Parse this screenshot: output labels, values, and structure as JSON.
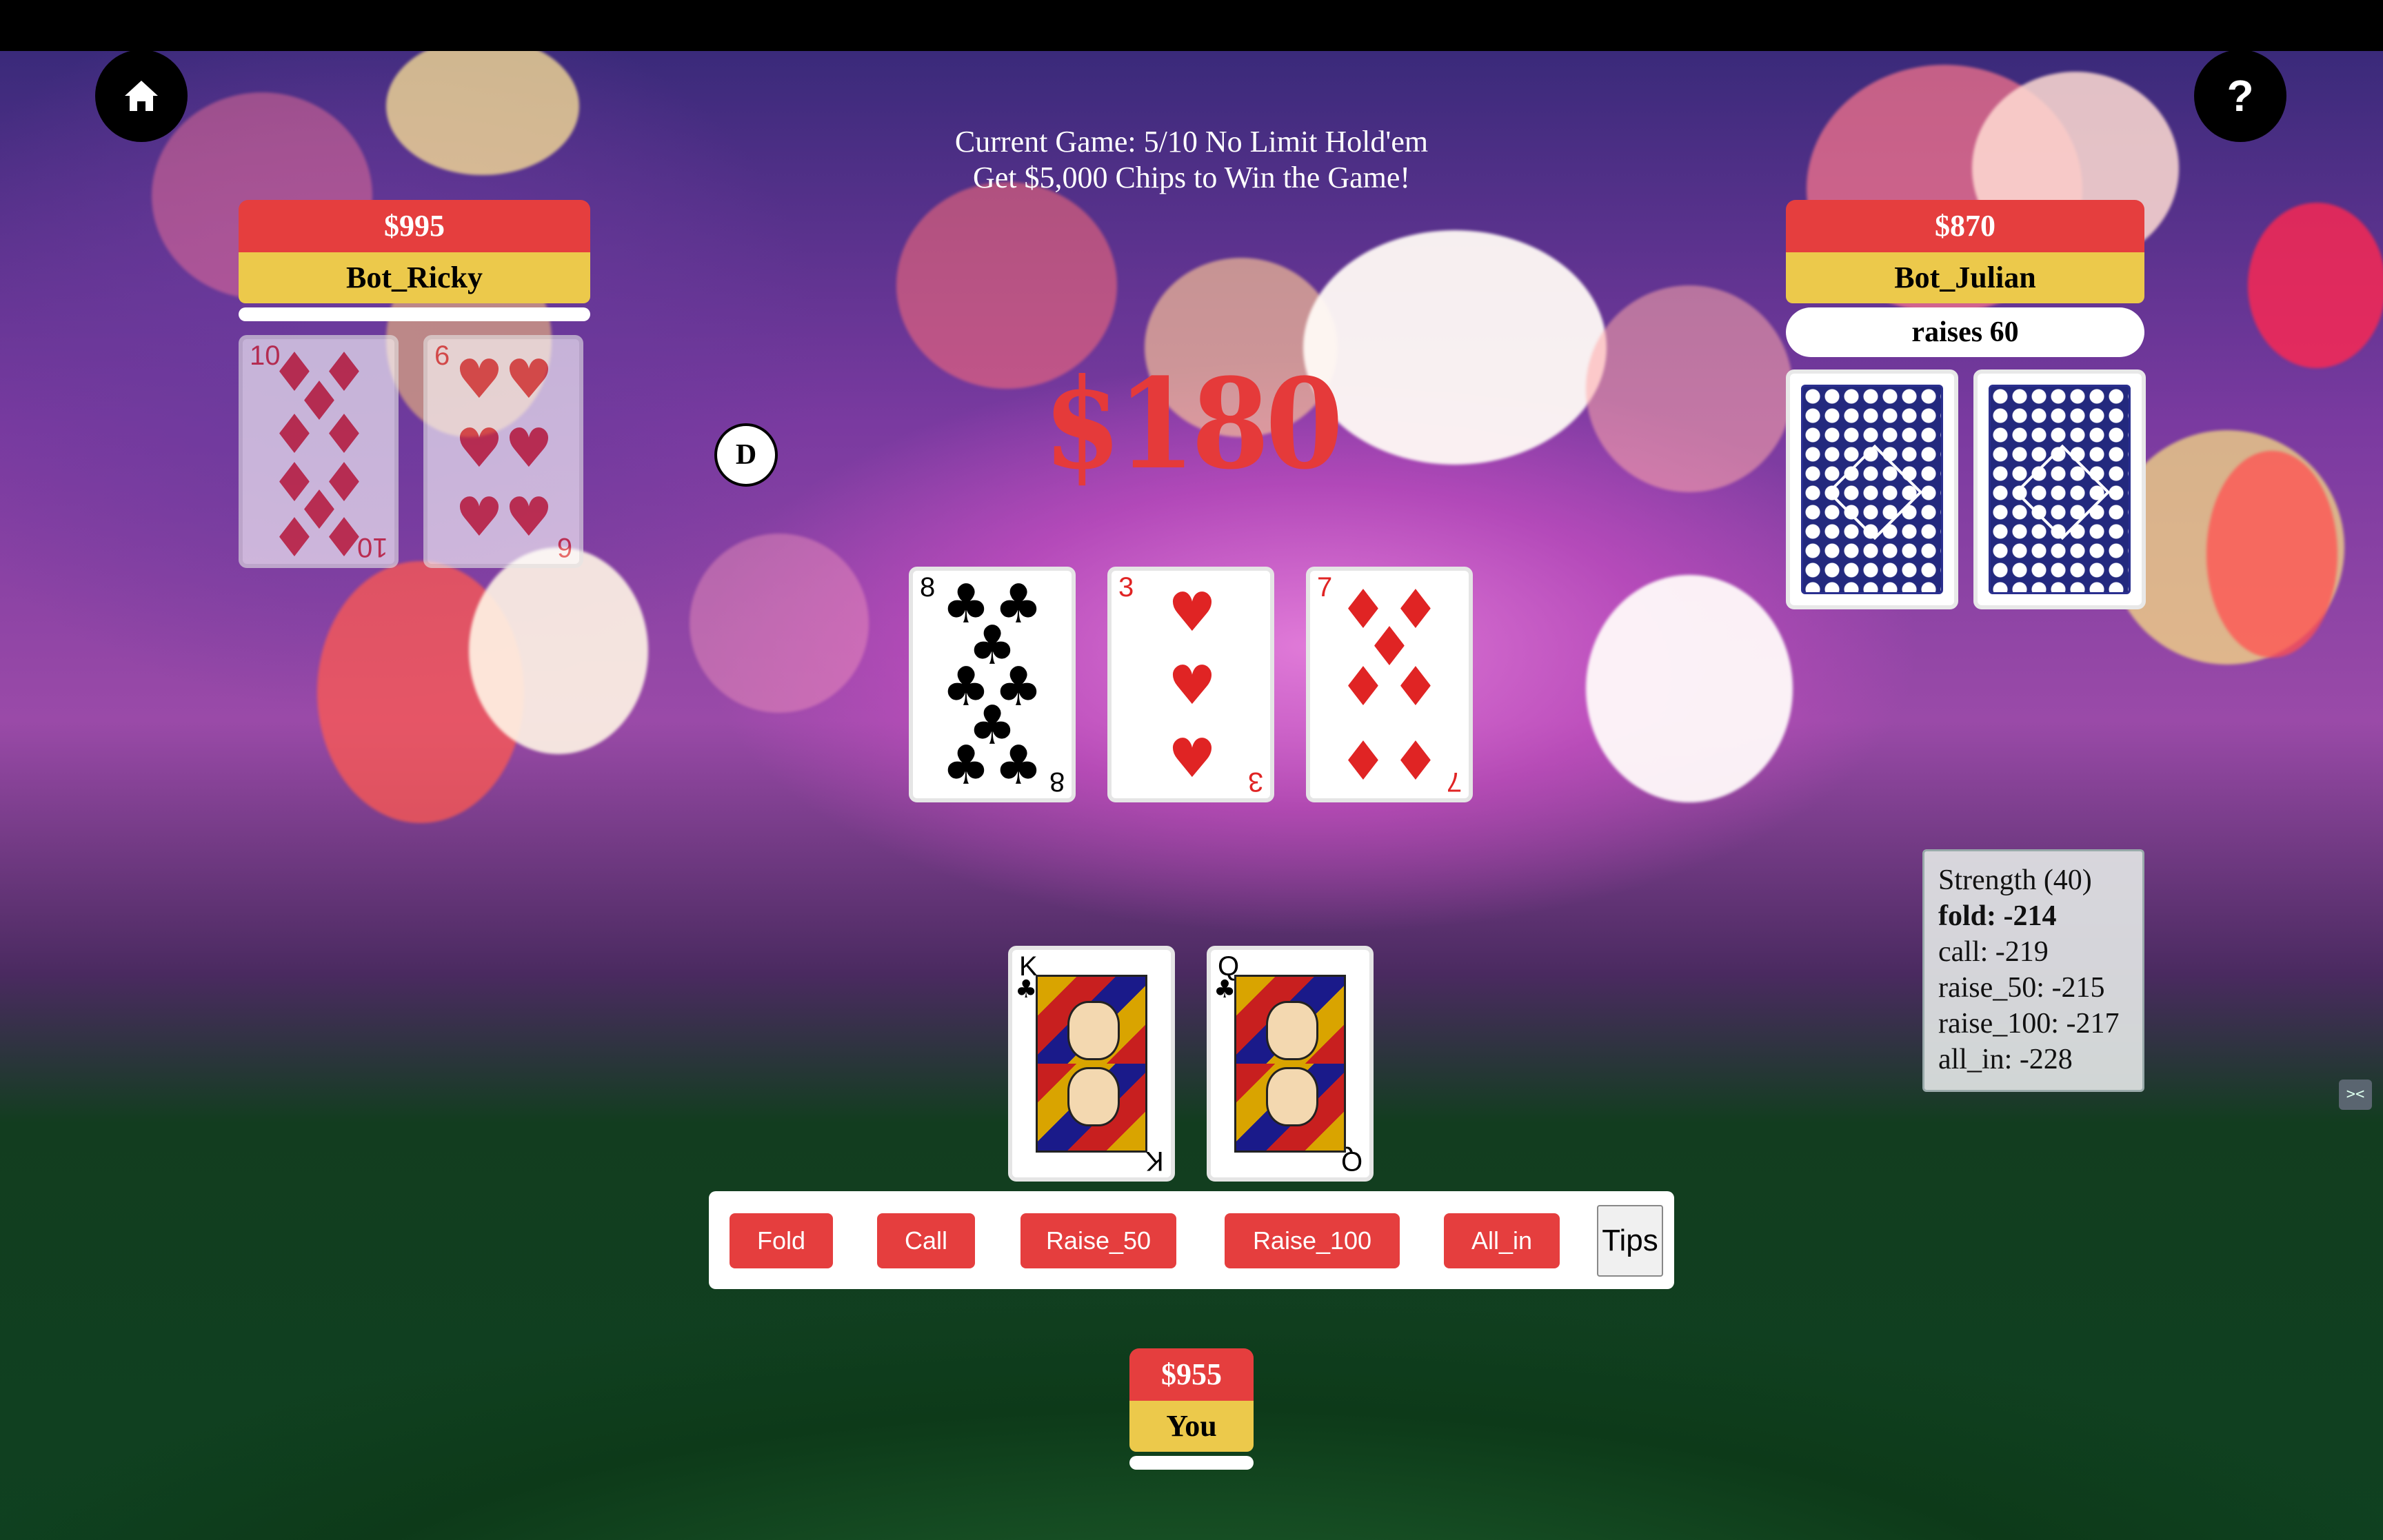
{
  "header": {
    "line1": "Current Game: 5/10 No Limit Hold'em",
    "line2": "Get $5,000 Chips to Win the Game!"
  },
  "nav": {
    "home_icon": "home-icon",
    "help_icon": "question-mark-icon",
    "help_glyph": "?"
  },
  "pot": "$180",
  "dealer_button": "D",
  "players": {
    "ricky": {
      "chips": "$995",
      "name": "Bot_Ricky",
      "action": "",
      "cards": [
        {
          "rank": "10",
          "suit": "♦",
          "color": "red"
        },
        {
          "rank": "6",
          "suit": "♥",
          "color": "red"
        }
      ]
    },
    "julian": {
      "chips": "$870",
      "name": "Bot_Julian",
      "action": "raises 60"
    },
    "you": {
      "chips": "$955",
      "name": "You",
      "action": "",
      "cards": [
        {
          "rank": "K",
          "suit": "♣",
          "color": "black"
        },
        {
          "rank": "Q",
          "suit": "♣",
          "color": "black"
        }
      ]
    }
  },
  "board": [
    {
      "rank": "8",
      "suit": "♣",
      "color": "black"
    },
    {
      "rank": "3",
      "suit": "♥",
      "color": "red"
    },
    {
      "rank": "7",
      "suit": "♦",
      "color": "red"
    }
  ],
  "strength": {
    "title": "Strength (40)",
    "fold": "fold: -214",
    "call": "call: -219",
    "raise_50": "raise_50: -215",
    "raise_100": "raise_100: -217",
    "all_in": "all_in: -228"
  },
  "controls": {
    "fold": "Fold",
    "call": "Call",
    "raise_50": "Raise_50",
    "raise_100": "Raise_100",
    "all_in": "All_in",
    "tips": "Tips"
  },
  "side_icon": "><"
}
